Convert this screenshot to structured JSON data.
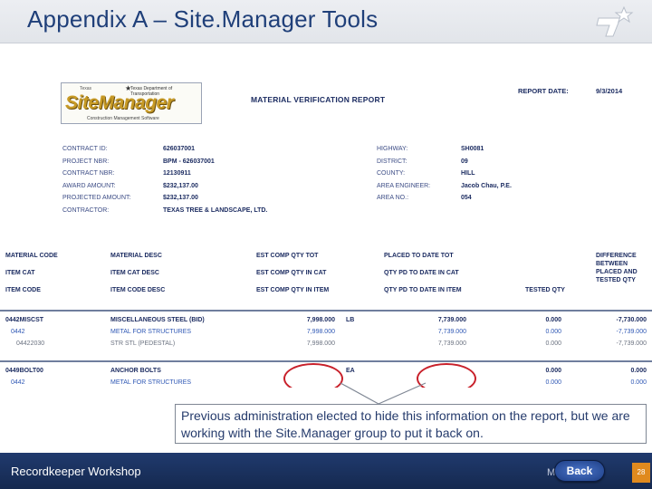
{
  "slide": {
    "title": "Appendix A – Site.Manager Tools"
  },
  "report": {
    "logo": {
      "small_top": "Texas",
      "agency": "Texas Department of Transportation",
      "name": "SiteManager",
      "sub": "Construction Management Software"
    },
    "title": "MATERIAL VERIFICATION REPORT",
    "date_label": "REPORT DATE:",
    "date_value": "9/3/2014",
    "left_fields": [
      {
        "label": "CONTRACT ID:",
        "value": "626037001"
      },
      {
        "label": "PROJECT NBR:",
        "value": "BPM - 626037001"
      },
      {
        "label": "CONTRACT NBR:",
        "value": "12130911"
      },
      {
        "label": "AWARD AMOUNT:",
        "value": "$232,137.00"
      },
      {
        "label": "PROJECTED AMOUNT:",
        "value": "$232,137.00"
      },
      {
        "label": "CONTRACTOR:",
        "value": "TEXAS TREE & LANDSCAPE, LTD."
      }
    ],
    "right_fields": [
      {
        "label": "HIGHWAY:",
        "value": "SH0081"
      },
      {
        "label": "DISTRICT:",
        "value": "09"
      },
      {
        "label": "COUNTY:",
        "value": "HILL"
      },
      {
        "label": "AREA ENGINEER:",
        "value": "Jacob Chau, P.E."
      },
      {
        "label": "AREA NO.:",
        "value": "054"
      }
    ],
    "columns": {
      "c1": [
        "MATERIAL CODE",
        "ITEM CAT",
        "ITEM CODE"
      ],
      "c2": [
        "MATERIAL DESC",
        "ITEM CAT DESC",
        "ITEM CODE DESC"
      ],
      "c3": [
        "EST COMP QTY TOT",
        "EST COMP QTY IN CAT",
        "EST COMP QTY IN ITEM"
      ],
      "c4": [
        "PLACED TO DATE TOT",
        "QTY PD TO DATE IN CAT",
        "QTY PD TO DATE IN ITEM"
      ],
      "c5": "TESTED QTY",
      "c6": [
        "DIFFERENCE",
        "BETWEEN",
        "PLACED AND",
        "TESTED QTY"
      ]
    },
    "rows": [
      {
        "code": "0442MISCST",
        "desc": "MISCELLANEOUS STEEL (BID)",
        "est": "7,998.000",
        "unit": "LB",
        "placed": "7,739.000",
        "tested": "0.000",
        "diff": "-7,730.000"
      },
      {
        "code": "0442",
        "desc": "METAL FOR STRUCTURES",
        "est": "7,998.000",
        "unit": "",
        "placed": "7,739.000",
        "tested": "0.000",
        "diff": "-7,739.000"
      },
      {
        "code": "04422030",
        "desc": "STR STL (PEDESTAL)",
        "est": "7,998.000",
        "unit": "",
        "placed": "7,739.000",
        "tested": "0.000",
        "diff": "-7,739.000"
      },
      {
        "code": "0449BOLT00",
        "desc": "ANCHOR BOLTS",
        "est": "",
        "unit": "EA",
        "placed": "",
        "tested": "0.000",
        "diff": "0.000"
      },
      {
        "code": "0442",
        "desc": "METAL FOR STRUCTURES",
        "est": "",
        "unit": "",
        "placed": "",
        "tested": "0.000",
        "diff": "0.000"
      }
    ]
  },
  "callout": {
    "text": "Previous administration elected to hide this information on the report, but we are working with the Site.Manager group to put it back on."
  },
  "footer": {
    "title": "Recordkeeper Workshop",
    "mo": "Mo",
    "back_label": "Back",
    "page_number": "28"
  },
  "colors": {
    "title_blue": "#1f3f79",
    "footer_navy": "#1b3060",
    "oval_red": "#c8202a",
    "page_orange": "#e08a1e"
  },
  "icons": [
    "txdot-star-logo-icon",
    "sitemanager-logo"
  ]
}
